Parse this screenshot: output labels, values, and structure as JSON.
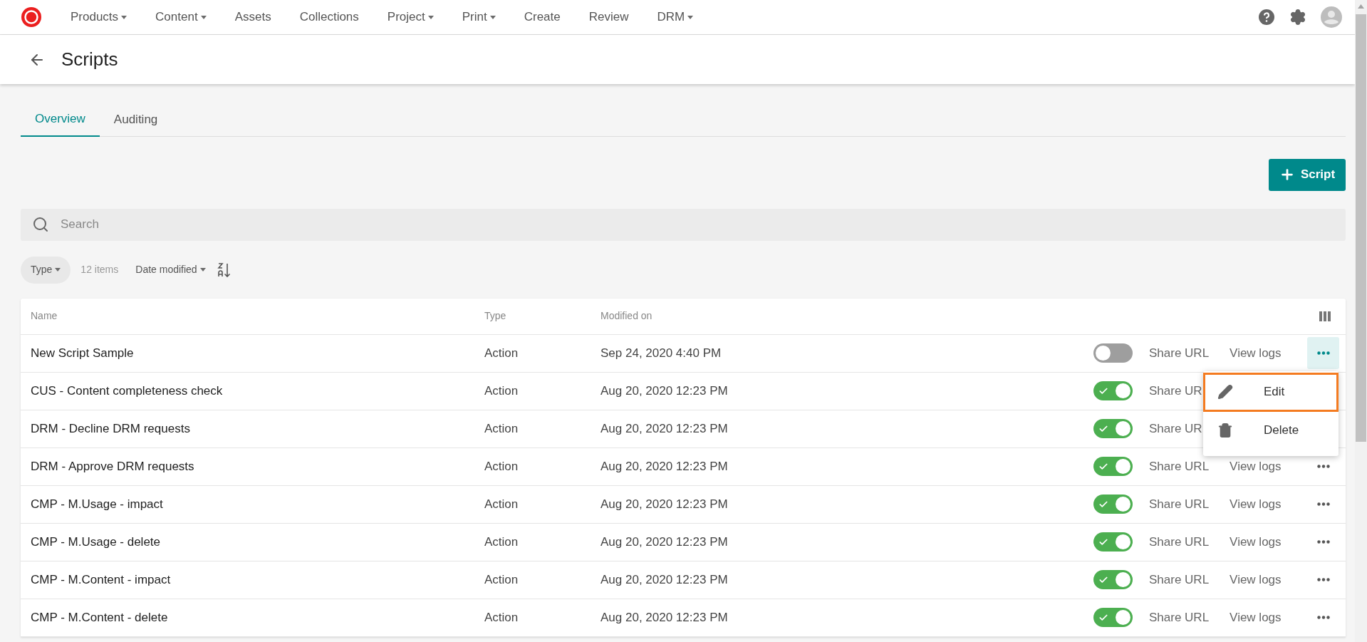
{
  "nav": {
    "items": [
      {
        "label": "Products",
        "dropdown": true
      },
      {
        "label": "Content",
        "dropdown": true
      },
      {
        "label": "Assets",
        "dropdown": false
      },
      {
        "label": "Collections",
        "dropdown": false
      },
      {
        "label": "Project",
        "dropdown": true
      },
      {
        "label": "Print",
        "dropdown": true
      },
      {
        "label": "Create",
        "dropdown": false
      },
      {
        "label": "Review",
        "dropdown": false
      },
      {
        "label": "DRM",
        "dropdown": true
      }
    ]
  },
  "page": {
    "title": "Scripts"
  },
  "tabs": [
    {
      "label": "Overview",
      "selected": true
    },
    {
      "label": "Auditing",
      "selected": false
    }
  ],
  "add_button": {
    "label": "Script"
  },
  "search": {
    "placeholder": "Search"
  },
  "filters": {
    "type": "Type",
    "count": "12 items",
    "sort": "Date modified"
  },
  "table": {
    "columns": [
      "Name",
      "Type",
      "Modified on"
    ],
    "rows": [
      {
        "name": "New Script Sample",
        "type": "Action",
        "modified": "Sep 24, 2020 4:40 PM",
        "on": false,
        "share": "Share URL",
        "logs": "View logs",
        "menu_open": true
      },
      {
        "name": "CUS - Content completeness check",
        "type": "Action",
        "modified": "Aug 20, 2020 12:23 PM",
        "on": true,
        "share": "Share UR"
      },
      {
        "name": "DRM - Decline DRM requests",
        "type": "Action",
        "modified": "Aug 20, 2020 12:23 PM",
        "on": true,
        "share": "Share UR"
      },
      {
        "name": "DRM - Approve DRM requests",
        "type": "Action",
        "modified": "Aug 20, 2020 12:23 PM",
        "on": true,
        "share": "Share URL",
        "logs": "View logs",
        "menu_open": false
      },
      {
        "name": "CMP - M.Usage - impact",
        "type": "Action",
        "modified": "Aug 20, 2020 12:23 PM",
        "on": true,
        "share": "Share URL",
        "logs": "View logs",
        "menu_open": false
      },
      {
        "name": "CMP - M.Usage - delete",
        "type": "Action",
        "modified": "Aug 20, 2020 12:23 PM",
        "on": true,
        "share": "Share URL",
        "logs": "View logs",
        "menu_open": false
      },
      {
        "name": "CMP - M.Content - impact",
        "type": "Action",
        "modified": "Aug 20, 2020 12:23 PM",
        "on": true,
        "share": "Share URL",
        "logs": "View logs",
        "menu_open": false
      },
      {
        "name": "CMP - M.Content - delete",
        "type": "Action",
        "modified": "Aug 20, 2020 12:23 PM",
        "on": true,
        "share": "Share URL",
        "logs": "View logs",
        "menu_open": false
      }
    ]
  },
  "menu": {
    "items": [
      {
        "label": "Edit",
        "kind": "edit",
        "selected": true
      },
      {
        "label": "Delete",
        "kind": "delete",
        "selected": false
      }
    ]
  }
}
